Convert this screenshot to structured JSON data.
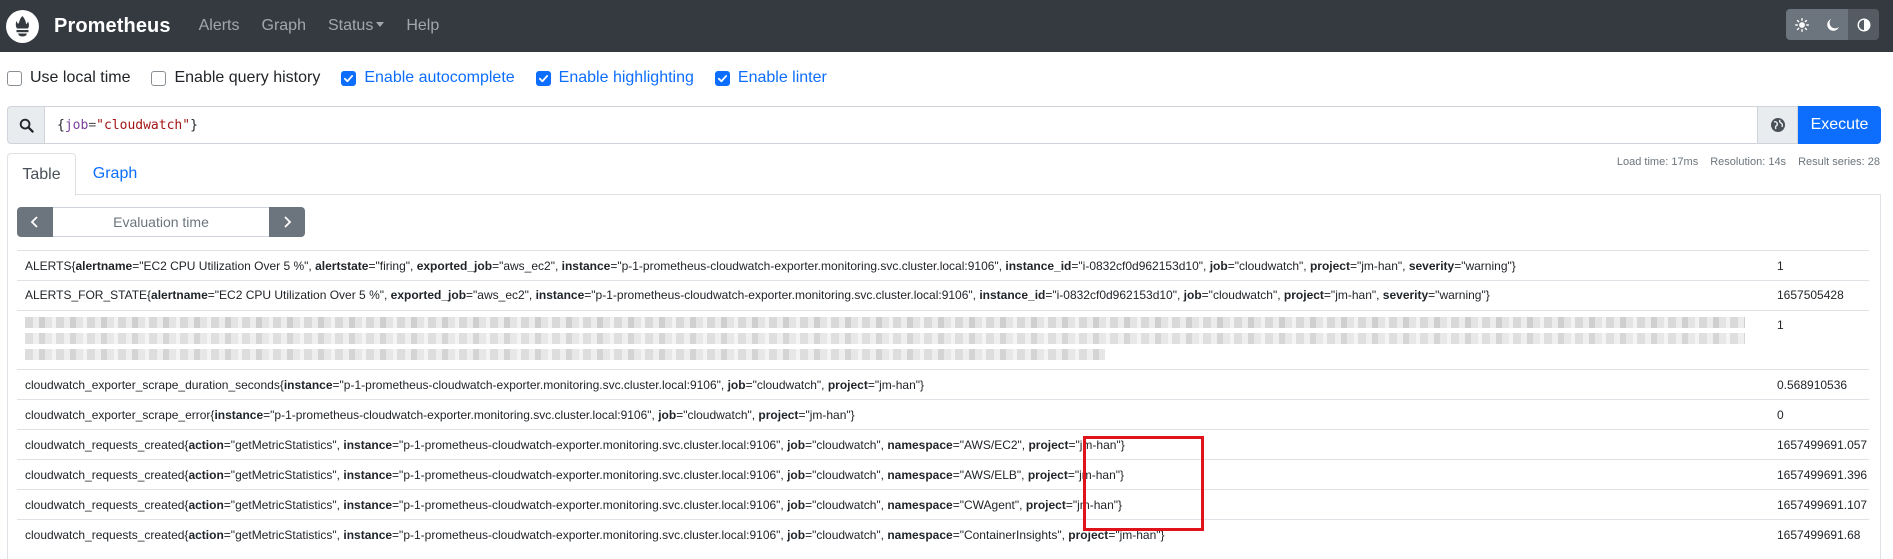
{
  "navbar": {
    "brand": "Prometheus",
    "links": [
      "Alerts",
      "Graph",
      "Status",
      "Help"
    ],
    "theme_buttons": [
      "light-theme-icon",
      "dark-theme-icon",
      "auto-theme-icon"
    ]
  },
  "options": [
    {
      "label": "Use local time",
      "checked": false
    },
    {
      "label": "Enable query history",
      "checked": false
    },
    {
      "label": "Enable autocomplete",
      "checked": true
    },
    {
      "label": "Enable highlighting",
      "checked": true
    },
    {
      "label": "Enable linter",
      "checked": true
    }
  ],
  "query": {
    "open": "{",
    "label": "job",
    "eq": "=",
    "value": "\"cloudwatch\"",
    "close": "}",
    "execute_label": "Execute"
  },
  "stats": {
    "load_time": "Load time: 17ms",
    "resolution": "Resolution: 14s",
    "result_series": "Result series: 28"
  },
  "tabs": {
    "table": "Table",
    "graph": "Graph"
  },
  "eval_time_placeholder": "Evaluation time",
  "rows": [
    {
      "name": "ALERTS",
      "labels": [
        [
          "alertname",
          "\"EC2 CPU Utilization Over 5 %\""
        ],
        [
          "alertstate",
          "\"firing\""
        ],
        [
          "exported_job",
          "\"aws_ec2\""
        ],
        [
          "instance",
          "\"p-1-prometheus-cloudwatch-exporter.monitoring.svc.cluster.local:9106\""
        ],
        [
          "instance_id",
          "\"i-0832cf0d962153d10\""
        ],
        [
          "job",
          "\"cloudwatch\""
        ],
        [
          "project",
          "\"jm-han\""
        ],
        [
          "severity",
          "\"warning\""
        ]
      ],
      "value": "1"
    },
    {
      "name": "ALERTS_FOR_STATE",
      "labels": [
        [
          "alertname",
          "\"EC2 CPU Utilization Over 5 %\""
        ],
        [
          "exported_job",
          "\"aws_ec2\""
        ],
        [
          "instance",
          "\"p-1-prometheus-cloudwatch-exporter.monitoring.svc.cluster.local:9106\""
        ],
        [
          "instance_id",
          "\"i-0832cf0d962153d10\""
        ],
        [
          "job",
          "\"cloudwatch\""
        ],
        [
          "project",
          "\"jm-han\""
        ],
        [
          "severity",
          "\"warning\""
        ]
      ],
      "value": "1657505428"
    },
    {
      "name": "",
      "labels": [],
      "value": "1"
    },
    {
      "name": "cloudwatch_exporter_scrape_duration_seconds",
      "labels": [
        [
          "instance",
          "\"p-1-prometheus-cloudwatch-exporter.monitoring.svc.cluster.local:9106\""
        ],
        [
          "job",
          "\"cloudwatch\""
        ],
        [
          "project",
          "\"jm-han\""
        ]
      ],
      "value": "0.568910536"
    },
    {
      "name": "cloudwatch_exporter_scrape_error",
      "labels": [
        [
          "instance",
          "\"p-1-prometheus-cloudwatch-exporter.monitoring.svc.cluster.local:9106\""
        ],
        [
          "job",
          "\"cloudwatch\""
        ],
        [
          "project",
          "\"jm-han\""
        ]
      ],
      "value": "0"
    },
    {
      "name": "cloudwatch_requests_created",
      "labels": [
        [
          "action",
          "\"getMetricStatistics\""
        ],
        [
          "instance",
          "\"p-1-prometheus-cloudwatch-exporter.monitoring.svc.cluster.local:9106\""
        ],
        [
          "job",
          "\"cloudwatch\""
        ],
        [
          "namespace",
          "\"AWS/EC2\""
        ],
        [
          "project",
          "\"jm-han\""
        ]
      ],
      "value": "1657499691.057"
    },
    {
      "name": "cloudwatch_requests_created",
      "labels": [
        [
          "action",
          "\"getMetricStatistics\""
        ],
        [
          "instance",
          "\"p-1-prometheus-cloudwatch-exporter.monitoring.svc.cluster.local:9106\""
        ],
        [
          "job",
          "\"cloudwatch\""
        ],
        [
          "namespace",
          "\"AWS/ELB\""
        ],
        [
          "project",
          "\"jm-han\""
        ]
      ],
      "value": "1657499691.396"
    },
    {
      "name": "cloudwatch_requests_created",
      "labels": [
        [
          "action",
          "\"getMetricStatistics\""
        ],
        [
          "instance",
          "\"p-1-prometheus-cloudwatch-exporter.monitoring.svc.cluster.local:9106\""
        ],
        [
          "job",
          "\"cloudwatch\""
        ],
        [
          "namespace",
          "\"CWAgent\""
        ],
        [
          "project",
          "\"jm-han\""
        ]
      ],
      "value": "1657499691.107"
    },
    {
      "name": "cloudwatch_requests_created",
      "labels": [
        [
          "action",
          "\"getMetricStatistics\""
        ],
        [
          "instance",
          "\"p-1-prometheus-cloudwatch-exporter.monitoring.svc.cluster.local:9106\""
        ],
        [
          "job",
          "\"cloudwatch\""
        ],
        [
          "namespace",
          "\"ContainerInsights\""
        ],
        [
          "project",
          "\"jm-han\""
        ]
      ],
      "value": "1657499691.68"
    }
  ]
}
